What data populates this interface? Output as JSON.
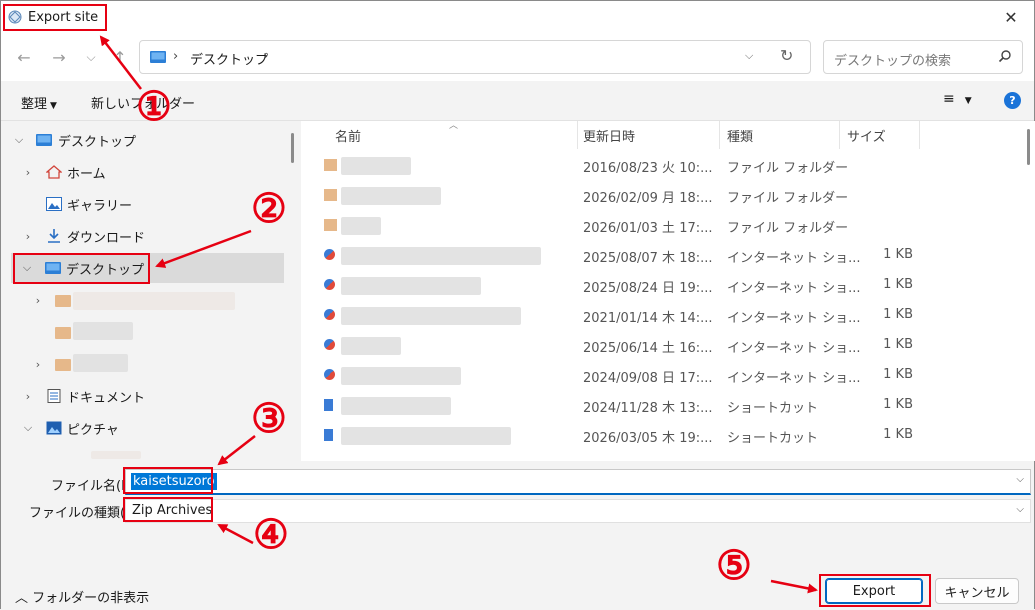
{
  "window": {
    "title": "Export site"
  },
  "nav": {
    "back": "←",
    "forward": "→",
    "recent": "⌵",
    "up": "↑",
    "path_part": "デスクトップ",
    "search_placeholder": "デスクトップの検索"
  },
  "toolbar": {
    "organize": "整理",
    "new_folder": "新しいフォルダー"
  },
  "tree": [
    {
      "label": "デスクトップ",
      "icon": "desktop-icon"
    },
    {
      "label": "ホーム",
      "icon": "home-icon"
    },
    {
      "label": "ギャラリー",
      "icon": "gallery-icon"
    },
    {
      "label": "ダウンロード",
      "icon": "download-icon"
    },
    {
      "label": "デスクトップ",
      "icon": "desktop-icon"
    },
    {
      "label": "ドキュメント",
      "icon": "document-icon"
    },
    {
      "label": "ピクチャ",
      "icon": "pictures-icon"
    }
  ],
  "columns": {
    "name": "名前",
    "date": "更新日時",
    "type": "種類",
    "size": "サイズ"
  },
  "files": [
    {
      "date": "2016/08/23 火 10:...",
      "type": "ファイル フォルダー",
      "size": "",
      "icon": "folder-icon"
    },
    {
      "date": "2026/02/09 月 18:...",
      "type": "ファイル フォルダー",
      "size": "",
      "icon": "folder-icon"
    },
    {
      "date": "2026/01/03 土 17:...",
      "type": "ファイル フォルダー",
      "size": "",
      "icon": "folder-icon"
    },
    {
      "date": "2025/08/07 木 18:...",
      "type": "インターネット ショ...",
      "size": "1 KB",
      "icon": "internet-shortcut-icon"
    },
    {
      "date": "2025/08/24 日 19:...",
      "type": "インターネット ショ...",
      "size": "1 KB",
      "icon": "internet-shortcut-icon"
    },
    {
      "date": "2021/01/14 木 14:...",
      "type": "インターネット ショ...",
      "size": "1 KB",
      "icon": "internet-shortcut-icon"
    },
    {
      "date": "2025/06/14 土 16:...",
      "type": "インターネット ショ...",
      "size": "1 KB",
      "icon": "internet-shortcut-icon"
    },
    {
      "date": "2024/09/08 日 17:...",
      "type": "インターネット ショ...",
      "size": "1 KB",
      "icon": "internet-shortcut-icon"
    },
    {
      "date": "2024/11/28 木 13:...",
      "type": "ショートカット",
      "size": "1 KB",
      "icon": "shortcut-icon"
    },
    {
      "date": "2026/03/05 木 19:...",
      "type": "ショートカット",
      "size": "1 KB",
      "icon": "shortcut-icon"
    }
  ],
  "filename": {
    "label": "ファイル名(N):",
    "value": "kaisetsuzoro"
  },
  "filetype": {
    "label": "ファイルの種類(T):",
    "value": "Zip Archives"
  },
  "footer": {
    "hide_folders": "フォルダーの非表示",
    "export": "Export",
    "cancel": "キャンセル"
  },
  "annotations": [
    "①",
    "②",
    "③",
    "④",
    "⑤"
  ],
  "colors": {
    "annotation": "#e60012",
    "accent": "#0078d7"
  }
}
